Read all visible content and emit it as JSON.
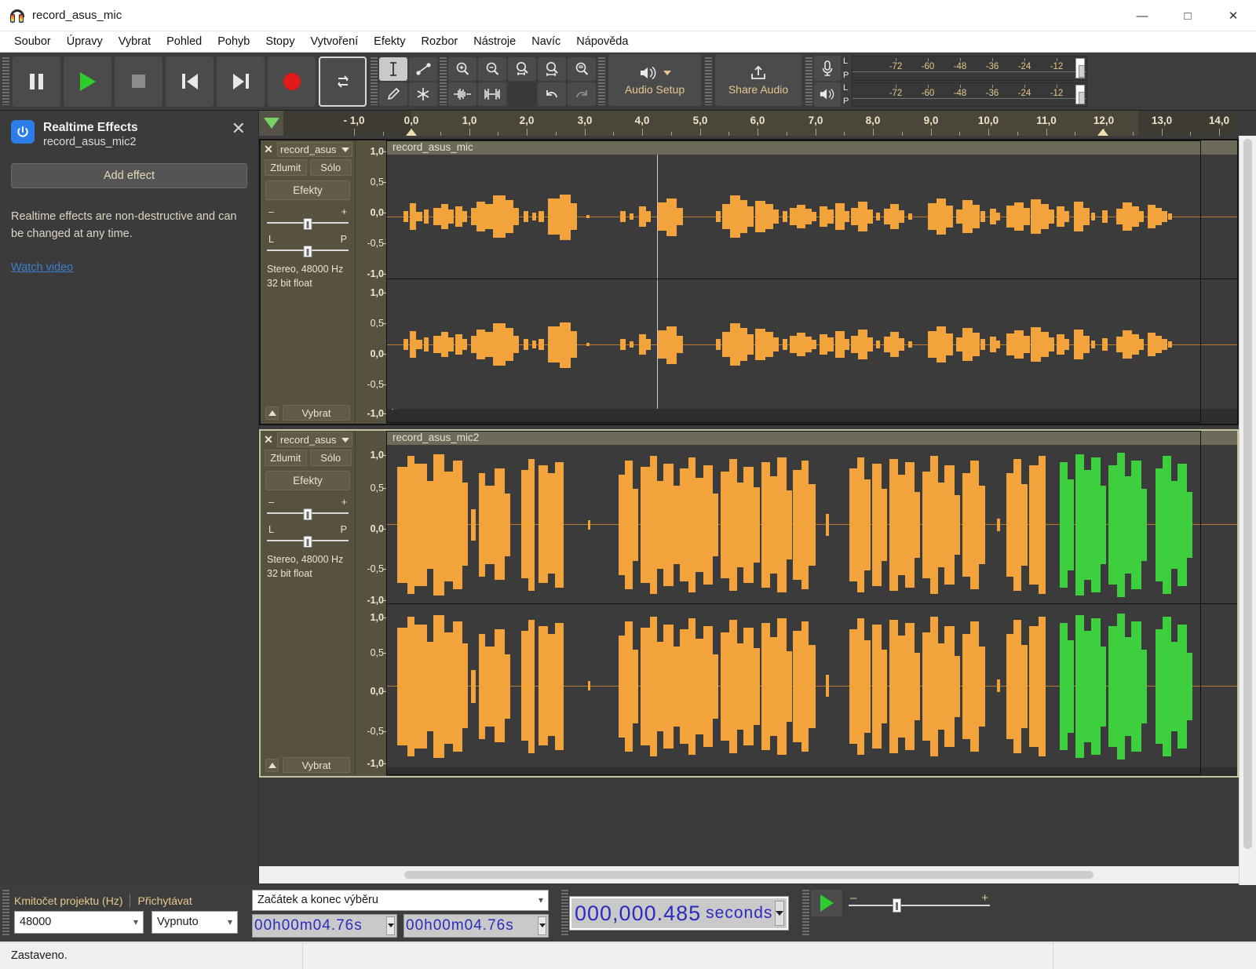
{
  "window": {
    "title": "record_asus_mic",
    "app_icon": "headphones-icon",
    "minimize": "—",
    "maximize": "□",
    "close": "✕"
  },
  "menu": {
    "items": [
      {
        "label": "Soubor"
      },
      {
        "label": "Úpravy"
      },
      {
        "label": "Vybrat"
      },
      {
        "label": "Pohled"
      },
      {
        "label": "Pohyb"
      },
      {
        "label": "Stopy"
      },
      {
        "label": "Vytvoření"
      },
      {
        "label": "Efekty"
      },
      {
        "label": "Rozbor"
      },
      {
        "label": "Nástroje"
      },
      {
        "label": "Navíc"
      },
      {
        "label": "Nápověda"
      }
    ]
  },
  "toolbar": {
    "transport": [
      {
        "name": "pause-button",
        "icon": "pause-icon"
      },
      {
        "name": "play-button",
        "icon": "play-icon"
      },
      {
        "name": "stop-button",
        "icon": "stop-icon"
      },
      {
        "name": "skip-to-start-button",
        "icon": "skip-start-icon"
      },
      {
        "name": "skip-to-end-button",
        "icon": "skip-end-icon"
      },
      {
        "name": "record-button",
        "icon": "record-icon"
      },
      {
        "name": "loop-button",
        "icon": "loop-icon"
      }
    ],
    "tools": [
      {
        "name": "selection-tool",
        "icon": "i-beam-icon",
        "selected": true
      },
      {
        "name": "envelope-tool",
        "icon": "envelope-icon",
        "selected": false
      },
      {
        "name": "draw-tool",
        "icon": "pencil-icon",
        "selected": false
      },
      {
        "name": "multi-tool",
        "icon": "asterisk-icon",
        "selected": false
      }
    ],
    "zoom_tools": [
      {
        "name": "zoom-in-button",
        "icon": "zoom-in-icon"
      },
      {
        "name": "zoom-out-button",
        "icon": "zoom-out-icon"
      },
      {
        "name": "fit-selection-button",
        "icon": "fit-selection-icon"
      },
      {
        "name": "fit-project-button",
        "icon": "fit-project-icon"
      },
      {
        "name": "zoom-toggle-button",
        "icon": "zoom-toggle-icon"
      },
      {
        "name": "trim-audio-button",
        "icon": "trim-outside-icon"
      },
      {
        "name": "silence-audio-button",
        "icon": "silence-selection-icon"
      },
      {
        "name": "undo-button",
        "icon": "undo-icon"
      },
      {
        "name": "redo-button",
        "icon": "redo-icon"
      }
    ],
    "audio_setup_label": "Audio Setup",
    "share_audio_label": "Share Audio",
    "meters": {
      "record_icon": "microphone-icon",
      "play_icon": "speaker-icon",
      "channel_top": "L",
      "channel_bottom": "P",
      "scale": [
        "-72",
        "-60",
        "-48",
        "-36",
        "-24",
        "-12"
      ]
    }
  },
  "effects_panel": {
    "power_icon": "power-icon",
    "title": "Realtime Effects",
    "subtitle": "record_asus_mic2",
    "close_icon": "close-icon",
    "add_effect_label": "Add effect",
    "description": "Realtime effects are non-destructive and can be changed at any time.",
    "watch_video_label": "Watch video",
    "accent_color": "#2b7de9",
    "link_color": "#3c7fd0"
  },
  "timeline": {
    "pin_icon": "pinned-play-head-icon",
    "labels": [
      "- 1,0",
      "0,0",
      "1,0",
      "2,0",
      "3,0",
      "4,0",
      "5,0",
      "6,0",
      "7,0",
      "8,0",
      "9,0",
      "10,0",
      "11,0",
      "12,0",
      "13,0",
      "14,0"
    ],
    "start_time": -1.0,
    "end_time": 14.4,
    "unit": "seconds"
  },
  "tracks": [
    {
      "name": "record_asus_mic",
      "control_name": "record_asus",
      "close_icon": "close-icon",
      "dropdown_icon": "chevron-down-icon",
      "mute_label": "Ztlumit",
      "solo_label": "Sólo",
      "effects_label": "Efekty",
      "gain_minus": "–",
      "gain_plus": "+",
      "pan_left": "L",
      "pan_right": "P",
      "info_line1": "Stereo, 48000 Hz",
      "info_line2": "32 bit float",
      "select_label": "Vybrat",
      "collapse_icon": "collapse-up-icon",
      "vscale": [
        "1,0",
        "0,5",
        "0,0",
        "-0,5",
        "-1,0"
      ],
      "selected": false,
      "waveform_color": "#f2a33c",
      "clip_start": 0.0,
      "clip_end": 12.95
    },
    {
      "name": "record_asus_mic2",
      "control_name": "record_asus",
      "close_icon": "close-icon",
      "dropdown_icon": "chevron-down-icon",
      "mute_label": "Ztlumit",
      "solo_label": "Sólo",
      "effects_label": "Efekty",
      "gain_minus": "–",
      "gain_plus": "+",
      "pan_left": "L",
      "pan_right": "P",
      "info_line1": "Stereo, 48000 Hz",
      "info_line2": "32 bit float",
      "select_label": "Vybrat",
      "collapse_icon": "collapse-up-icon",
      "vscale": [
        "1,0",
        "0,5",
        "0,0",
        "-0,5",
        "-1,0"
      ],
      "selected": true,
      "waveform_color": "#f2a33c",
      "highlight_color": "#3ecf3e",
      "clip_start": 0.0,
      "clip_end": 12.95
    }
  ],
  "selection_bar": {
    "project_rate_label": "Kmitočet projektu (Hz)",
    "snap_label": "Přichytávat",
    "project_rate_value": "48000",
    "snap_value": "Vypnuto",
    "selection_mode": "Začátek a konec výběru",
    "selection_start": "00h00m04.76s",
    "selection_end": "00h00m04.76s",
    "audio_position": "000,000.485",
    "audio_position_unit": "seconds",
    "play_icon": "play-icon",
    "speed_minus": "–",
    "speed_plus": "+"
  },
  "status": {
    "message": "Zastaveno."
  }
}
